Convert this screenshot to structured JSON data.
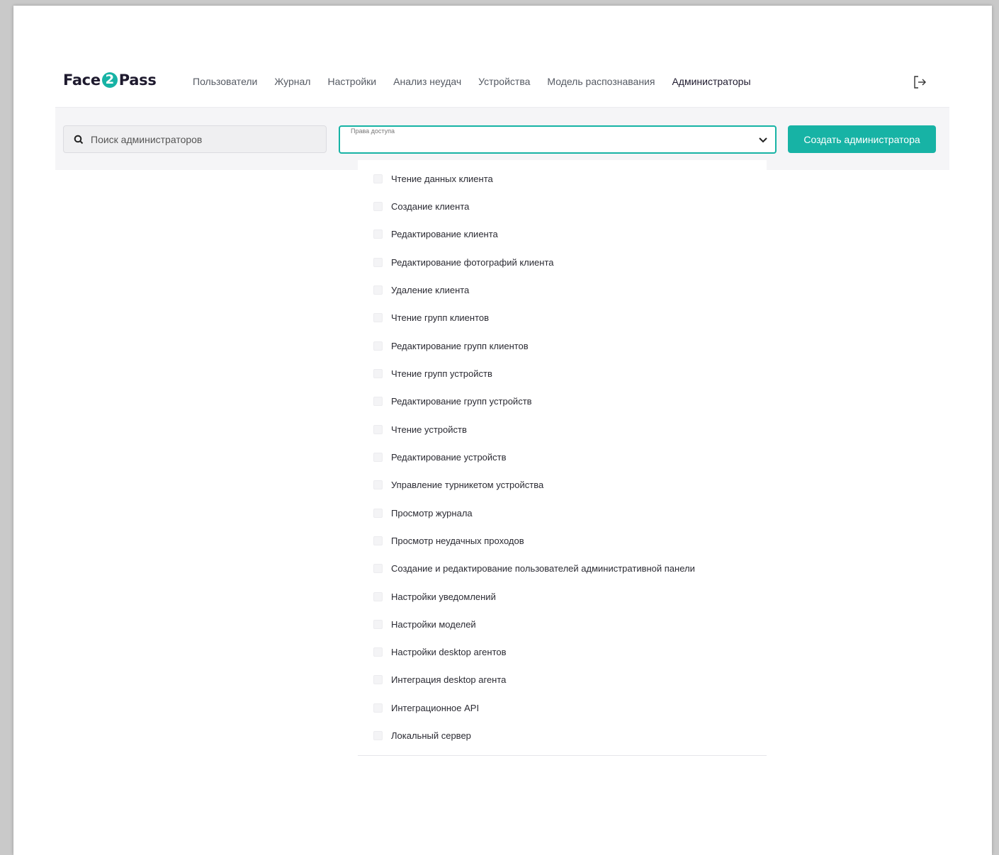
{
  "app": {
    "logo_left": "Face",
    "logo_digit": "2",
    "logo_right": "Pass",
    "nav": [
      {
        "label": "Пользователи",
        "active": false
      },
      {
        "label": "Журнал",
        "active": false
      },
      {
        "label": "Настройки",
        "active": false
      },
      {
        "label": "Анализ неудач",
        "active": false
      },
      {
        "label": "Устройства",
        "active": false
      },
      {
        "label": "Модель распознавания",
        "active": false
      },
      {
        "label": "Администраторы",
        "active": true
      }
    ],
    "logout_icon": "logout-icon"
  },
  "toolbar": {
    "search_placeholder": "Поиск администраторов",
    "search_value": "",
    "permissions_label": "Права доступа",
    "permissions_value": "",
    "create_label": "Создать администратора"
  },
  "permissions_options": [
    "Чтение данных клиента",
    "Создание клиента",
    "Редактирование клиента",
    "Редактирование фотографий клиента",
    "Удаление клиента",
    "Чтение групп клиентов",
    "Редактирование групп клиентов",
    "Чтение групп устройств",
    "Редактирование групп устройств",
    "Чтение устройств",
    "Редактирование устройств",
    "Управление турникетом устройства",
    "Просмотр журнала",
    "Просмотр неудачных проходов",
    "Создание и редактирование пользователей административной панели",
    "Настройки уведомлений",
    "Настройки моделей",
    "Настройки desktop агентов",
    "Интеграция desktop агента",
    "Интеграционное API",
    "Локальный сервер"
  ],
  "colors": {
    "accent": "#17b3a5",
    "text_dark": "#1e1a2e",
    "toolbar_bg": "#f5f5f7"
  }
}
